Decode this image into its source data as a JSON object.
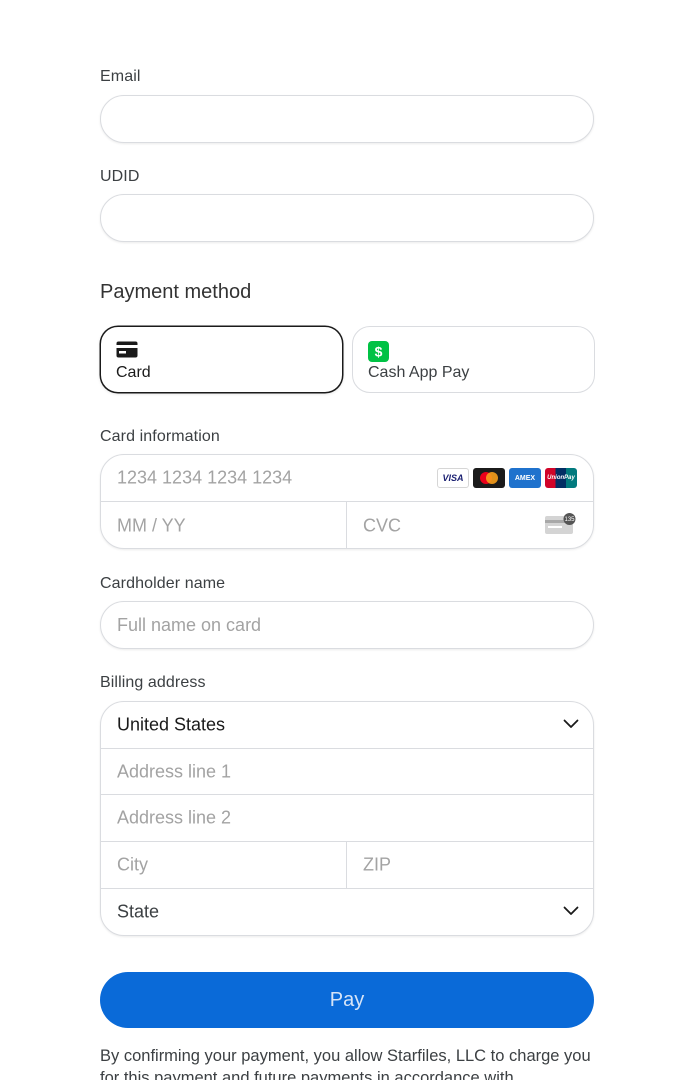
{
  "email": {
    "label": "Email",
    "value": "",
    "placeholder": ""
  },
  "udid": {
    "label": "UDID",
    "value": "",
    "placeholder": ""
  },
  "payment_method": {
    "title": "Payment method",
    "options": [
      {
        "label": "Card",
        "icon": "credit-card-icon",
        "selected": true
      },
      {
        "label": "Cash App Pay",
        "icon": "cash-app-icon",
        "selected": false,
        "icon_color": "#00c244"
      }
    ]
  },
  "card_information": {
    "label": "Card information",
    "number_placeholder": "1234 1234 1234 1234",
    "expiry_placeholder": "MM / YY",
    "cvc_placeholder": "CVC",
    "cvc_icon_text": "135",
    "brands": [
      {
        "name": "VISA",
        "icon": "visa-icon"
      },
      {
        "name": "mastercard",
        "icon": "mastercard-icon"
      },
      {
        "name": "AMEX",
        "icon": "amex-icon"
      },
      {
        "name": "UnionPay",
        "icon": "unionpay-icon"
      }
    ]
  },
  "cardholder": {
    "label": "Cardholder name",
    "placeholder": "Full name on card"
  },
  "billing": {
    "label": "Billing address",
    "country": "United States",
    "line1_placeholder": "Address line 1",
    "line2_placeholder": "Address line 2",
    "city_placeholder": "City",
    "zip_placeholder": "ZIP",
    "state_placeholder": "State"
  },
  "pay_button": {
    "label": "Pay",
    "color": "#0a6ad8"
  },
  "legal_text": "By confirming your payment, you allow Starfiles, LLC to charge you for this payment and future payments in accordance with"
}
